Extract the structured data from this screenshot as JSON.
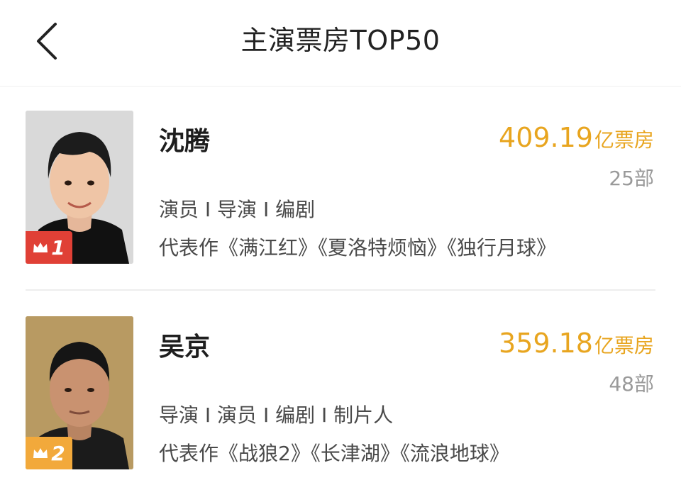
{
  "header": {
    "title": "主演票房TOP50"
  },
  "actors": [
    {
      "rank": "1",
      "name": "沈腾",
      "box_office": "409.19",
      "box_unit": "亿票房",
      "films": "25部",
      "roles": "演员 I 导演 I 编剧",
      "works": "代表作《满江红》《夏洛特烦恼》《独行月球》"
    },
    {
      "rank": "2",
      "name": "吴京",
      "box_office": "359.18",
      "box_unit": "亿票房",
      "films": "48部",
      "roles": "导演 I 演员 I 编剧 I 制片人",
      "works": "代表作《战狼2》《长津湖》《流浪地球》"
    }
  ],
  "colors": {
    "accent": "#e8a51f",
    "rank1_badge": "#e04036",
    "rank2_badge": "#f2a93b"
  },
  "icons": {
    "back": "chevron-left-icon",
    "crown": "crown-icon"
  }
}
